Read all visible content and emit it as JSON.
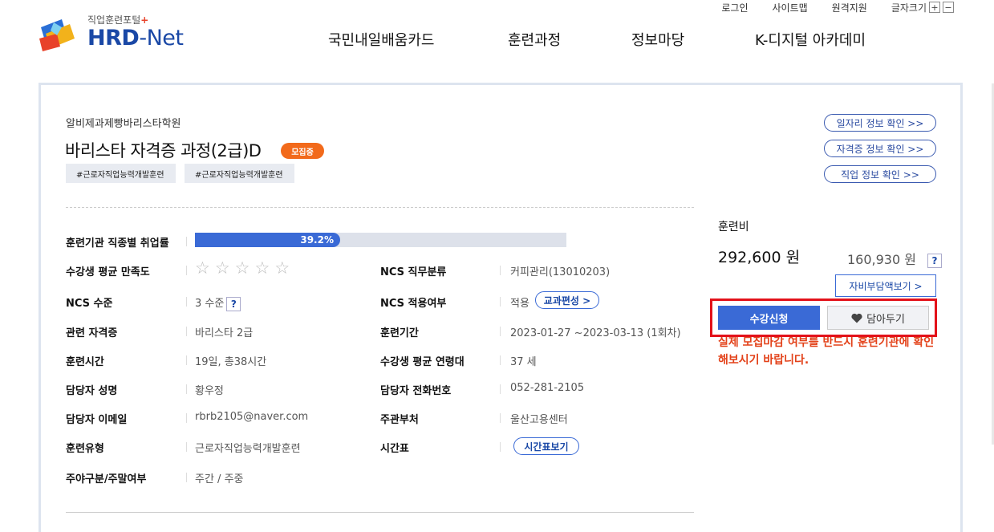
{
  "utility": {
    "login": "로그인",
    "sitemap": "사이트맵",
    "remote": "원격지원",
    "font_size": "글자크기",
    "plus": "+",
    "minus": "−"
  },
  "logo": {
    "subtitle": "직업훈련포털",
    "subtitle_plus": "+",
    "hrd": "HRD",
    "dash": "-",
    "net": "Net"
  },
  "gnb": [
    "국민내일배움카드",
    "훈련과정",
    "정보마당",
    "K-디지털 아카데미"
  ],
  "course": {
    "institution": "알비제과제빵바리스타학원",
    "title": "바리스타 자격증 과정(2급)D",
    "badge": "모집중",
    "tags": [
      "#근로자직업능력개발훈련",
      "#근로자직업능력개발훈련"
    ]
  },
  "links": [
    "일자리 정보 확인 >>",
    "자격증 정보 확인 >>",
    "직업 정보 확인 >>"
  ],
  "employment": {
    "label": "훈련기관 직종별 취업률",
    "value": "39.2%",
    "fraction": 0.392
  },
  "details": {
    "satisfaction_label": "수강생 평균 만족도",
    "stars": [
      "☆",
      "☆",
      "☆",
      "☆",
      "☆"
    ],
    "ncs_class_label": "NCS 직무분류",
    "ncs_class_value": "커피관리(13010203)",
    "ncs_level_label": "NCS 수준",
    "ncs_level_value": "3 수준",
    "help_mark": "?",
    "ncs_apply_label": "NCS 적용여부",
    "ncs_apply_value": "적용",
    "curriculum_btn": "교과편성 >",
    "cert_label": "관련 자격증",
    "cert_value": "바리스타 2급",
    "period_label": "훈련기간",
    "period_value": "2023-01-27 ~2023-03-13 (1회차)",
    "hours_label": "훈련시간",
    "hours_value": "19일, 총38시간",
    "age_label": "수강생 평균 연령대",
    "age_value": "37 세",
    "manager_label": "담당자 성명",
    "manager_value": "황우정",
    "phone_label": "담당자 전화번호",
    "phone_value": "052-281-2105",
    "email_label": "담당자 이메일",
    "email_value": "rbrb2105@naver.com",
    "dept_label": "주관부처",
    "dept_value": "울산고용센터",
    "type_label": "훈련유형",
    "type_value": "근로자직업능력개발훈련",
    "timetable_label": "시간표",
    "timetable_btn": "시간표보기",
    "daynight_label": "주야구분/주말여부",
    "daynight_value": "주간 / 주중"
  },
  "fee": {
    "label": "훈련비",
    "total": "292,600 원",
    "self": "160,930 원",
    "self_pay_btn": "자비부담액보기 >"
  },
  "actions": {
    "apply": "수강신청",
    "save": "담아두기"
  },
  "notice": "실제 모집마감 여부를 반드시 훈련기관에 확인해보시기 바랍니다.",
  "colors": {
    "primary": "#3a6ad6",
    "badge": "#f26a1b",
    "highlight_box": "#e3121a",
    "notice": "#e3421a"
  }
}
